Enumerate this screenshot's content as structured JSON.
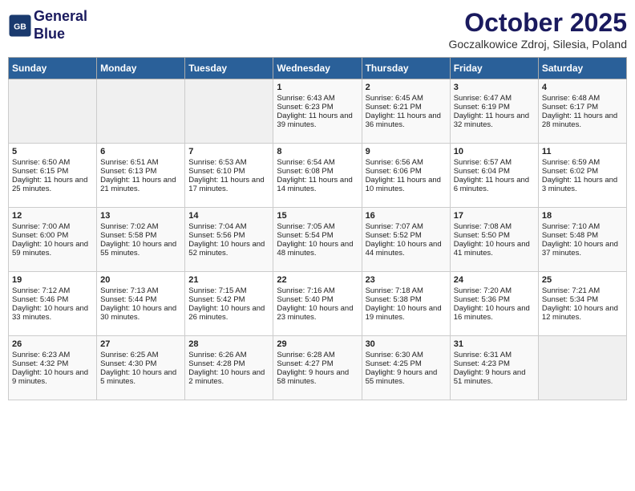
{
  "header": {
    "logo_line1": "General",
    "logo_line2": "Blue",
    "month": "October 2025",
    "location": "Goczalkowice Zdroj, Silesia, Poland"
  },
  "days_of_week": [
    "Sunday",
    "Monday",
    "Tuesday",
    "Wednesday",
    "Thursday",
    "Friday",
    "Saturday"
  ],
  "weeks": [
    [
      {
        "day": "",
        "content": ""
      },
      {
        "day": "",
        "content": ""
      },
      {
        "day": "",
        "content": ""
      },
      {
        "day": "1",
        "content": "Sunrise: 6:43 AM\nSunset: 6:23 PM\nDaylight: 11 hours and 39 minutes."
      },
      {
        "day": "2",
        "content": "Sunrise: 6:45 AM\nSunset: 6:21 PM\nDaylight: 11 hours and 36 minutes."
      },
      {
        "day": "3",
        "content": "Sunrise: 6:47 AM\nSunset: 6:19 PM\nDaylight: 11 hours and 32 minutes."
      },
      {
        "day": "4",
        "content": "Sunrise: 6:48 AM\nSunset: 6:17 PM\nDaylight: 11 hours and 28 minutes."
      }
    ],
    [
      {
        "day": "5",
        "content": "Sunrise: 6:50 AM\nSunset: 6:15 PM\nDaylight: 11 hours and 25 minutes."
      },
      {
        "day": "6",
        "content": "Sunrise: 6:51 AM\nSunset: 6:13 PM\nDaylight: 11 hours and 21 minutes."
      },
      {
        "day": "7",
        "content": "Sunrise: 6:53 AM\nSunset: 6:10 PM\nDaylight: 11 hours and 17 minutes."
      },
      {
        "day": "8",
        "content": "Sunrise: 6:54 AM\nSunset: 6:08 PM\nDaylight: 11 hours and 14 minutes."
      },
      {
        "day": "9",
        "content": "Sunrise: 6:56 AM\nSunset: 6:06 PM\nDaylight: 11 hours and 10 minutes."
      },
      {
        "day": "10",
        "content": "Sunrise: 6:57 AM\nSunset: 6:04 PM\nDaylight: 11 hours and 6 minutes."
      },
      {
        "day": "11",
        "content": "Sunrise: 6:59 AM\nSunset: 6:02 PM\nDaylight: 11 hours and 3 minutes."
      }
    ],
    [
      {
        "day": "12",
        "content": "Sunrise: 7:00 AM\nSunset: 6:00 PM\nDaylight: 10 hours and 59 minutes."
      },
      {
        "day": "13",
        "content": "Sunrise: 7:02 AM\nSunset: 5:58 PM\nDaylight: 10 hours and 55 minutes."
      },
      {
        "day": "14",
        "content": "Sunrise: 7:04 AM\nSunset: 5:56 PM\nDaylight: 10 hours and 52 minutes."
      },
      {
        "day": "15",
        "content": "Sunrise: 7:05 AM\nSunset: 5:54 PM\nDaylight: 10 hours and 48 minutes."
      },
      {
        "day": "16",
        "content": "Sunrise: 7:07 AM\nSunset: 5:52 PM\nDaylight: 10 hours and 44 minutes."
      },
      {
        "day": "17",
        "content": "Sunrise: 7:08 AM\nSunset: 5:50 PM\nDaylight: 10 hours and 41 minutes."
      },
      {
        "day": "18",
        "content": "Sunrise: 7:10 AM\nSunset: 5:48 PM\nDaylight: 10 hours and 37 minutes."
      }
    ],
    [
      {
        "day": "19",
        "content": "Sunrise: 7:12 AM\nSunset: 5:46 PM\nDaylight: 10 hours and 33 minutes."
      },
      {
        "day": "20",
        "content": "Sunrise: 7:13 AM\nSunset: 5:44 PM\nDaylight: 10 hours and 30 minutes."
      },
      {
        "day": "21",
        "content": "Sunrise: 7:15 AM\nSunset: 5:42 PM\nDaylight: 10 hours and 26 minutes."
      },
      {
        "day": "22",
        "content": "Sunrise: 7:16 AM\nSunset: 5:40 PM\nDaylight: 10 hours and 23 minutes."
      },
      {
        "day": "23",
        "content": "Sunrise: 7:18 AM\nSunset: 5:38 PM\nDaylight: 10 hours and 19 minutes."
      },
      {
        "day": "24",
        "content": "Sunrise: 7:20 AM\nSunset: 5:36 PM\nDaylight: 10 hours and 16 minutes."
      },
      {
        "day": "25",
        "content": "Sunrise: 7:21 AM\nSunset: 5:34 PM\nDaylight: 10 hours and 12 minutes."
      }
    ],
    [
      {
        "day": "26",
        "content": "Sunrise: 6:23 AM\nSunset: 4:32 PM\nDaylight: 10 hours and 9 minutes."
      },
      {
        "day": "27",
        "content": "Sunrise: 6:25 AM\nSunset: 4:30 PM\nDaylight: 10 hours and 5 minutes."
      },
      {
        "day": "28",
        "content": "Sunrise: 6:26 AM\nSunset: 4:28 PM\nDaylight: 10 hours and 2 minutes."
      },
      {
        "day": "29",
        "content": "Sunrise: 6:28 AM\nSunset: 4:27 PM\nDaylight: 9 hours and 58 minutes."
      },
      {
        "day": "30",
        "content": "Sunrise: 6:30 AM\nSunset: 4:25 PM\nDaylight: 9 hours and 55 minutes."
      },
      {
        "day": "31",
        "content": "Sunrise: 6:31 AM\nSunset: 4:23 PM\nDaylight: 9 hours and 51 minutes."
      },
      {
        "day": "",
        "content": ""
      }
    ]
  ]
}
